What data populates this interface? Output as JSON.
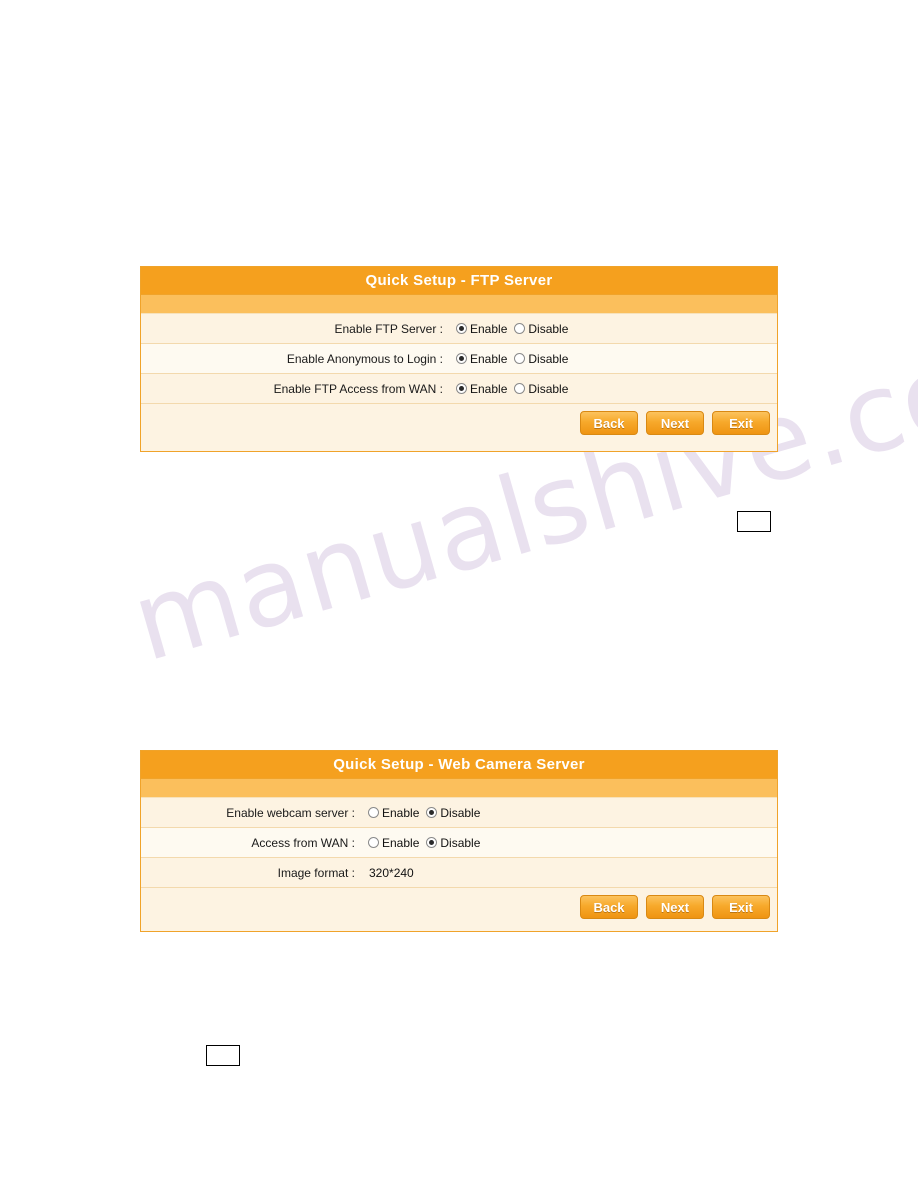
{
  "watermark": {
    "text": "manualshive.com"
  },
  "panels": [
    {
      "title": "Quick Setup - FTP Server",
      "rows": [
        {
          "label": "Enable FTP Server :",
          "type": "radio",
          "options": [
            {
              "label": "Enable",
              "checked": true
            },
            {
              "label": "Disable",
              "checked": false
            }
          ]
        },
        {
          "label": "Enable Anonymous to Login :",
          "type": "radio",
          "options": [
            {
              "label": "Enable",
              "checked": true
            },
            {
              "label": "Disable",
              "checked": false
            }
          ]
        },
        {
          "label": "Enable FTP Access from WAN :",
          "type": "radio",
          "options": [
            {
              "label": "Enable",
              "checked": true
            },
            {
              "label": "Disable",
              "checked": false
            }
          ]
        }
      ],
      "buttons": [
        {
          "label": "Back"
        },
        {
          "label": "Next"
        },
        {
          "label": "Exit"
        }
      ]
    },
    {
      "title": "Quick Setup - Web Camera Server",
      "rows": [
        {
          "label": "Enable webcam server :",
          "type": "radio",
          "options": [
            {
              "label": "Enable",
              "checked": false
            },
            {
              "label": "Disable",
              "checked": true
            }
          ]
        },
        {
          "label": "Access from WAN :",
          "type": "radio",
          "options": [
            {
              "label": "Enable",
              "checked": false
            },
            {
              "label": "Disable",
              "checked": true
            }
          ]
        },
        {
          "label": "Image format :",
          "type": "text",
          "value": "320*240"
        }
      ],
      "buttons": [
        {
          "label": "Back"
        },
        {
          "label": "Next"
        },
        {
          "label": "Exit"
        }
      ]
    }
  ],
  "page_markers": [
    {
      "text": ""
    },
    {
      "text": ""
    }
  ]
}
